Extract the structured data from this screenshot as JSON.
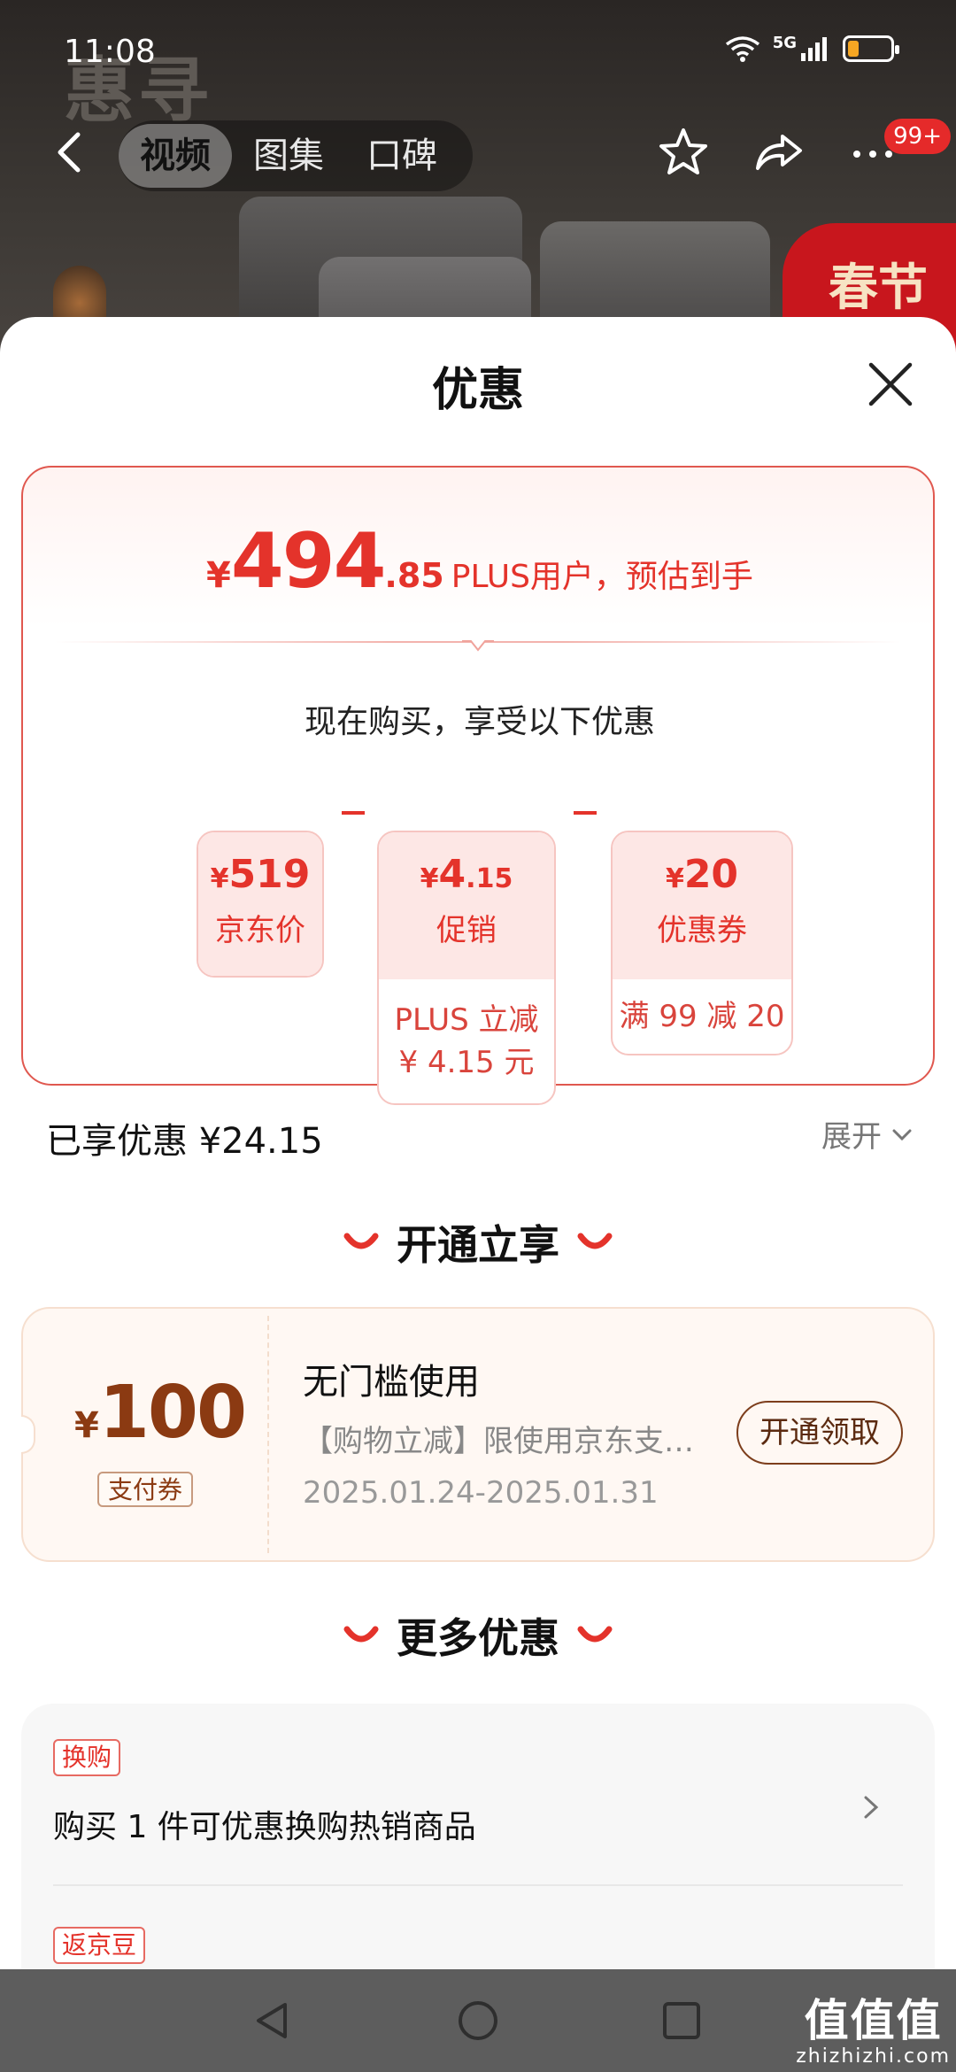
{
  "status_bar": {
    "time": "11:08",
    "network": "5G",
    "battery_level": 0.25
  },
  "background_page": {
    "logo_text": "惠寻",
    "badge_text": "春节",
    "tabs": [
      {
        "label": "视频",
        "active": true
      },
      {
        "label": "图集",
        "active": false
      },
      {
        "label": "口碑",
        "active": false
      }
    ],
    "more_badge": "99+"
  },
  "sheet": {
    "title": "优惠",
    "price": {
      "currency": "¥",
      "integer": "494",
      "decimal": ".85",
      "note": "PLUS用户，预估到手"
    },
    "enjoy_text": "现在购买，享受以下优惠",
    "breakdown": [
      {
        "currency": "¥",
        "amount": "519",
        "amount_small": "",
        "label": "京东价",
        "desc": ""
      },
      {
        "currency": "¥",
        "amount": "4",
        "amount_small": ".15",
        "label": "促销",
        "desc_line1": "PLUS 立减",
        "desc_line2": "¥ 4.15 元"
      },
      {
        "currency": "¥",
        "amount": "20",
        "amount_small": "",
        "label": "优惠券",
        "desc_line1": "满 99 减 20"
      }
    ],
    "saved_text": "已享优惠 ¥24.15",
    "expand_label": "展开",
    "open_section": {
      "title": "开通立享",
      "coupon": {
        "currency": "¥",
        "amount": "100",
        "tag": "支付券",
        "title": "无门槛使用",
        "desc": "【购物立减】限使用京东支付…",
        "date": "2025.01.24-2025.01.31",
        "button": "开通领取"
      }
    },
    "more_section": {
      "title": "更多优惠",
      "offers": [
        {
          "tag": "换购",
          "text": "购买 1 件可优惠换购热销商品"
        },
        {
          "tag": "返京豆",
          "text": ""
        }
      ]
    }
  },
  "watermark": {
    "big": "值值值",
    "small": "zhizhizhi.com"
  },
  "colors": {
    "accent": "#e4332b",
    "coupon_brown": "#8b3a12",
    "sys_nav": "#5d5d5d"
  }
}
